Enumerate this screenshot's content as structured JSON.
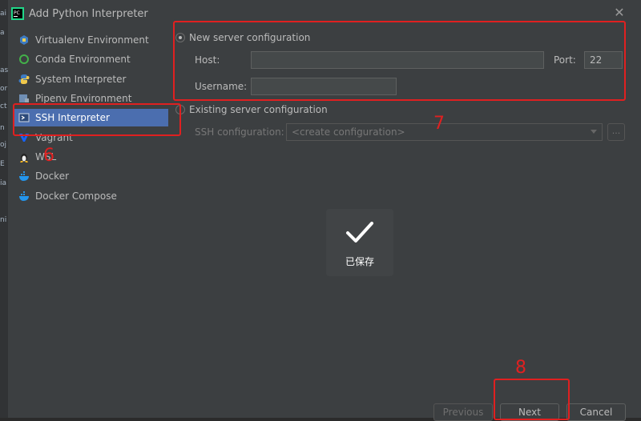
{
  "window": {
    "title": "Add Python Interpreter"
  },
  "side_strip": [
    "ai",
    "a",
    "as",
    "or",
    "ct",
    "n",
    "oj",
    "E",
    "ia",
    "ni"
  ],
  "sidebar": {
    "items": [
      {
        "label": "Virtualenv Environment",
        "icon": "virtualenv-icon",
        "selected": false
      },
      {
        "label": "Conda Environment",
        "icon": "conda-icon",
        "selected": false
      },
      {
        "label": "System Interpreter",
        "icon": "python-icon",
        "selected": false
      },
      {
        "label": "Pipenv Environment",
        "icon": "pipenv-icon",
        "selected": false
      },
      {
        "label": "SSH Interpreter",
        "icon": "ssh-icon",
        "selected": true
      },
      {
        "label": "Vagrant",
        "icon": "vagrant-icon",
        "selected": false
      },
      {
        "label": "WSL",
        "icon": "linux-icon",
        "selected": false
      },
      {
        "label": "Docker",
        "icon": "docker-icon",
        "selected": false
      },
      {
        "label": "Docker Compose",
        "icon": "docker-compose-icon",
        "selected": false
      }
    ]
  },
  "config": {
    "new_server_label": "New server configuration",
    "host_label": "Host:",
    "host_value": "",
    "port_label": "Port:",
    "port_value": "22",
    "username_label": "Username:",
    "username_value": "",
    "existing_server_label": "Existing server configuration",
    "ssh_config_label": "SSH configuration:",
    "ssh_config_value": "<create configuration>",
    "browse_label": "..."
  },
  "toast": {
    "text": "已保存",
    "icon": "checkmark-icon"
  },
  "footer": {
    "previous_label": "Previous",
    "next_label": "Next",
    "cancel_label": "Cancel"
  },
  "annotations": {
    "label_6": "6",
    "label_7": "7",
    "label_8": "8",
    "color": "#e02020"
  },
  "colors": {
    "background": "#3c3f41",
    "selection": "#4b6eaf",
    "text": "#bbbbbb"
  }
}
